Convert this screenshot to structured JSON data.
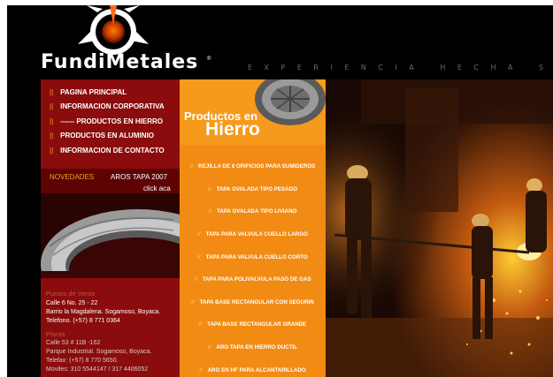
{
  "brand": {
    "name": "FundiMetales",
    "tagline": "EXPERIENCIA HECHA SOLIDEZ",
    "reg": "®"
  },
  "nav": {
    "items": [
      {
        "label": "PAGINA PRINCIPAL"
      },
      {
        "label": "INFORMACION CORPORATIVA"
      },
      {
        "label": "------ PRODUCTOS EN HIERRO"
      },
      {
        "label": "PRODUCTOS EN ALUMINIO"
      },
      {
        "label": "INFORMACION DE CONTACTO"
      }
    ],
    "separator": "||"
  },
  "news": {
    "label": "NOVEDADES",
    "title": "AROS TAPA 2007",
    "link": "click aca"
  },
  "contact": {
    "sales_heading": "Puntos de Venta",
    "sales_lines": [
      "Calle 6 No. 25 - 22",
      "Barrio la Magdalena. Sogamoso, Boyaca.",
      "Telefono. (+57) 8 771 0364"
    ],
    "plant_heading": "Planta",
    "plant_lines": [
      "Calle 53 # 11B -162",
      "Parque Industrial. Sogamoso, Boyaca.",
      "Telefax: (+57) 8 770 5650.",
      "Moviles: 310 5544147 / 317 4406052"
    ]
  },
  "products": {
    "title_line1": "Productos en",
    "title_line2": "Hierro",
    "separator": "//",
    "items": [
      "REJILLA DE 8 ORIFICIOS PARA SUMIDEROS",
      "TAPA OVALADA TIPO PESADO",
      "TAPA OVALADA TIPO LIVIANO",
      "TAPA PARA VALVULA CUELLO LARGO",
      "TAPA PARA VALVULA CUELLO CORTO",
      "TAPA PARA POLIVALVULA PASO DE GAS",
      "TAPA BASE RECTANGULAR CON SEGURIN",
      "TAPA BASE RECTANGULAR GRANDE",
      "ARO TAPA EN HIERRO DUCTIL",
      "ARO EN HF PARA ALCANTARILLADO"
    ]
  },
  "colors": {
    "red": "#8b0c0c",
    "orange": "#f28b14",
    "accent": "#f3a31a"
  }
}
